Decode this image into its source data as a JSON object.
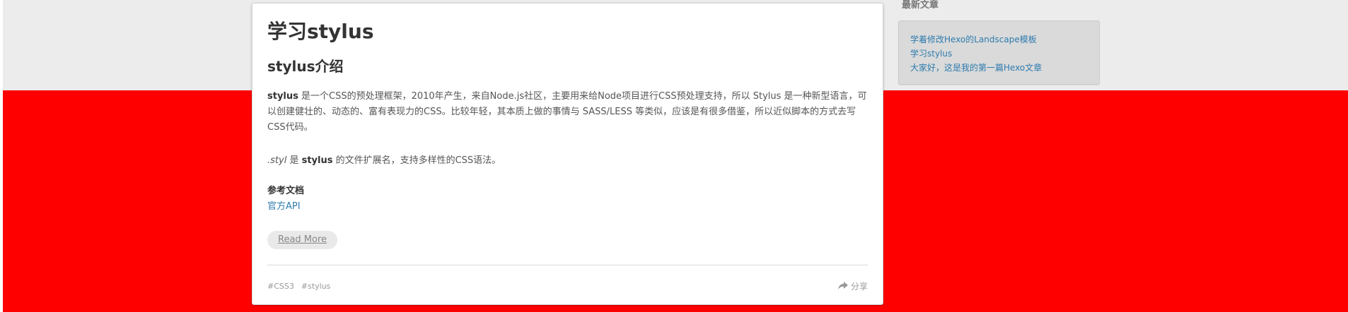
{
  "article": {
    "title": "学习stylus",
    "subtitle": "stylus介绍",
    "para1": {
      "strong": "stylus",
      "rest": " 是一个CSS的预处理框架，2010年产生，来自Node.js社区，主要用来给Node项目进行CSS预处理支持，所以 Stylus 是一种新型语言，可以创建健壮的、动态的、富有表现力的CSS。比较年轻，其本质上做的事情与 SASS/LESS 等类似，应该是有很多借鉴，所以近似脚本的方式去写CSS代码。"
    },
    "para2": {
      "em": ".styl",
      "mid": " 是 ",
      "strong": "stylus",
      "rest": " 的文件扩展名，支持多样性的CSS语法。"
    },
    "ref_label": "参考文档",
    "ref_link": "官方API",
    "read_more": "Read More",
    "tags": [
      "#CSS3",
      "#stylus"
    ],
    "share_label": "分享",
    "share_icon": "share-icon"
  },
  "sidebar": {
    "title": "最新文章",
    "recent_posts": [
      "学着修改Hexo的Landscape模板",
      "学习stylus",
      "大家好，这是我的第一篇Hexo文章"
    ]
  },
  "colors": {
    "link": "#2e7bae",
    "red_background": "#ff0000",
    "gray_background": "#ececec"
  }
}
